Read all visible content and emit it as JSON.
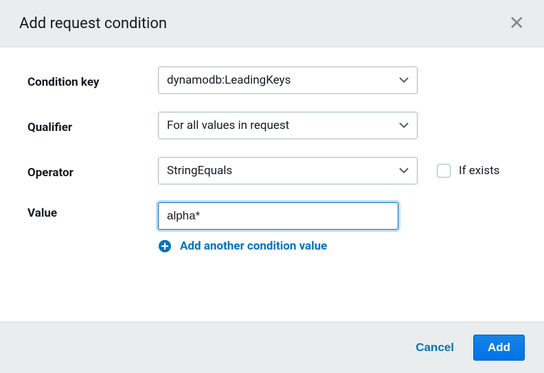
{
  "header": {
    "title": "Add request condition"
  },
  "labels": {
    "conditionKey": "Condition key",
    "qualifier": "Qualifier",
    "operator": "Operator",
    "value": "Value",
    "ifExists": "If exists"
  },
  "values": {
    "conditionKey": "dynamodb:LeadingKeys",
    "qualifier": "For all values in request",
    "operator": "StringEquals",
    "value": "alpha*"
  },
  "actions": {
    "addAnother": "Add another condition value",
    "cancel": "Cancel",
    "add": "Add"
  }
}
